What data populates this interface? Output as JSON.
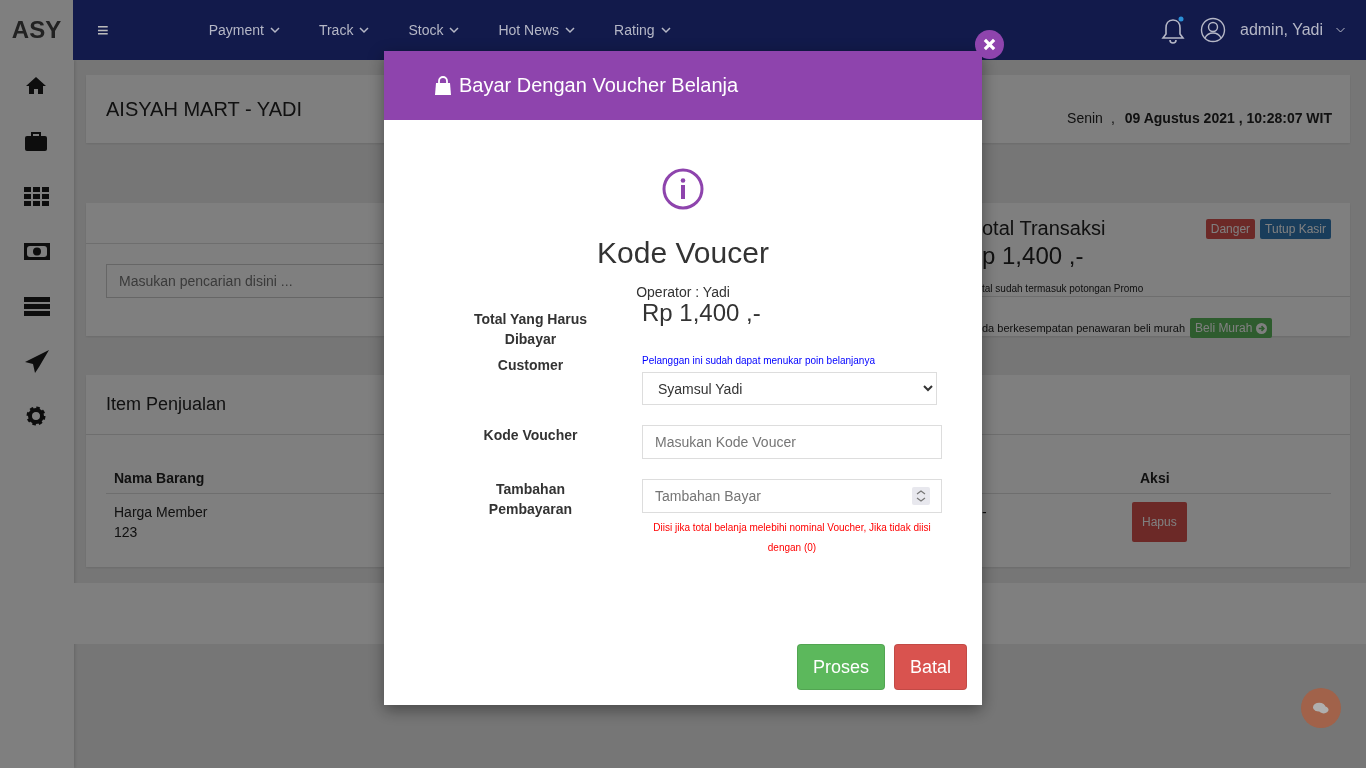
{
  "navbar": {
    "brand": "ASY",
    "menu_icon": "≡",
    "items": [
      {
        "label": "Payment"
      },
      {
        "label": "Track"
      },
      {
        "label": "Stock"
      },
      {
        "label": "Hot News"
      },
      {
        "label": "Rating"
      }
    ],
    "user": "admin, Yadi"
  },
  "header": {
    "title": "AISYAH MART - YADI",
    "day": "Senin",
    "separator": ",",
    "datetime": "09 Agustus 2021 , 10:28:07 WIT"
  },
  "search": {
    "placeholder": "Masukan pencarian disini ..."
  },
  "summary": {
    "title": "otal Transaksi",
    "amount": "p 1,400 ,-",
    "note": "tal sudah termasuk potongan Promo",
    "buttons": [
      {
        "label": "Danger",
        "kind": "danger"
      },
      {
        "label": "Tutup Kasir",
        "kind": "primary"
      }
    ],
    "promo_text": "da berkesempatan penawaran beli murah",
    "promo_button": "Beli Murah"
  },
  "items": {
    "title": "Item Penjualan",
    "columns": [
      "Nama Barang",
      "Aksi"
    ],
    "rows": [
      {
        "name": "Harga Member",
        "code": "123",
        "column_3": "-",
        "action": "Hapus"
      }
    ]
  },
  "modal": {
    "title": "Bayar Dengan Voucher Belanja",
    "heading": "Kode Voucer",
    "operator": "Operator : Yadi",
    "total_label": "Total Yang Harus Dibayar",
    "total": "Rp 1,400 ,-",
    "customer_label": "Customer",
    "customer_note": "Pelanggan ini sudah dapat menukar poin belanjanya",
    "customer": "Syamsul Yadi",
    "voucher_label": "Kode Voucher",
    "voucher_placeholder": "Masukan Kode Voucer",
    "extra_label": "Tambahan Pembayaran",
    "extra_placeholder": "Tambahan Bayar",
    "extra_help": "Diisi jika total belanja melebihi nominal Voucher, Jika tidak diisi dengan (0)",
    "buttons": [
      {
        "label": "Proses",
        "kind": "success"
      },
      {
        "label": "Batal",
        "kind": "danger"
      }
    ]
  }
}
